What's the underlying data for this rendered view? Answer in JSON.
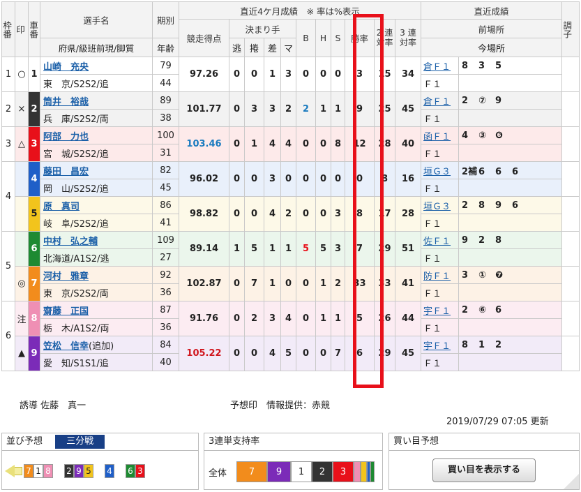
{
  "header": {
    "waku": "枠番",
    "shirushi": "印",
    "sha": "車番",
    "player_line1": "選手名",
    "player_line2": "府県/級班前現/脚質",
    "period_line1": "期別",
    "period_line2": "年齢",
    "recent4": "直近4ケ月成績　※ 率は%表示",
    "score": "競走得点",
    "kimarite": "決まり手",
    "nige": "逃",
    "makuri": "捲",
    "sashi": "差",
    "ma": "マ",
    "b": "B",
    "h": "H",
    "s": "S",
    "win_rate": "勝率",
    "ren2": "2 連 対率",
    "ren3": "3 連 対率",
    "recent_results": "直近成績",
    "prev_venue": "前場所",
    "this_venue": "今場所",
    "condition": "調子"
  },
  "riders": [
    {
      "waku": "1",
      "mark": "○",
      "car": "1",
      "car_bg": "#ffffff",
      "car_fg": "#222222",
      "row_bg": "#ffffff",
      "name": "山崎　充央",
      "pref": "東　京/S2S2/追",
      "period": "79",
      "age": "44",
      "score": "97.26",
      "score_color": "#222222",
      "nige": "0",
      "makuri": "0",
      "sashi": "1",
      "ma": "3",
      "b": "0",
      "h": "0",
      "s": "0",
      "b_color": "#222222",
      "win": "3",
      "ren2": "15",
      "ren3": "34",
      "prev": "倉Ｆ１",
      "prev_res": [
        "8",
        "3",
        "5"
      ],
      "cur": "Ｆ１"
    },
    {
      "waku": "2",
      "mark": "×",
      "car": "2",
      "car_bg": "#333333",
      "car_fg": "#ffffff",
      "row_bg": "#f2f2f2",
      "name": "筒井　裕哉",
      "pref": "兵　庫/S2S2/両",
      "period": "89",
      "age": "38",
      "score": "101.77",
      "score_color": "#222222",
      "nige": "0",
      "makuri": "3",
      "sashi": "3",
      "ma": "2",
      "b": "2",
      "h": "1",
      "s": "1",
      "b_color": "#1a7bbf",
      "win": "9",
      "ren2": "25",
      "ren3": "45",
      "prev": "倉Ｆ１",
      "prev_res": [
        "2",
        "⑦",
        "9"
      ],
      "cur": "Ｆ１"
    },
    {
      "waku": "3",
      "mark": "△",
      "car": "3",
      "car_bg": "#e8101a",
      "car_fg": "#ffffff",
      "row_bg": "#fdeaea",
      "name": "阿部　力也",
      "pref": "宮　城/S2S2/追",
      "period": "100",
      "age": "31",
      "score": "103.46",
      "score_color": "#1a7bbf",
      "nige": "0",
      "makuri": "1",
      "sashi": "4",
      "ma": "4",
      "b": "0",
      "h": "0",
      "s": "8",
      "b_color": "#222222",
      "win": "12",
      "ren2": "28",
      "ren3": "40",
      "prev": "函Ｆ１",
      "prev_res": [
        "4",
        "③",
        "❻"
      ],
      "cur": "Ｆ１"
    },
    {
      "waku": "4",
      "mark": "",
      "car": "4",
      "car_bg": "#1f5fc8",
      "car_fg": "#ffffff",
      "row_bg": "#e9f0fb",
      "name": "藤田　昌宏",
      "pref": "岡　山/S2S2/追",
      "period": "82",
      "age": "45",
      "score": "96.02",
      "score_color": "#222222",
      "nige": "0",
      "makuri": "0",
      "sashi": "3",
      "ma": "0",
      "b": "0",
      "h": "0",
      "s": "0",
      "b_color": "#222222",
      "win": "0",
      "ren2": "8",
      "ren3": "16",
      "prev": "垣Ｇ３",
      "prev_res": [
        "2補",
        "6",
        "6",
        "6"
      ],
      "cur": "Ｆ１"
    },
    {
      "waku": "",
      "mark": "",
      "car": "5",
      "car_bg": "#f2c41c",
      "car_fg": "#222222",
      "row_bg": "#fdf9e8",
      "name": "原　真司",
      "pref": "岐　阜/S2S2/追",
      "period": "86",
      "age": "41",
      "score": "98.82",
      "score_color": "#222222",
      "nige": "0",
      "makuri": "0",
      "sashi": "4",
      "ma": "2",
      "b": "0",
      "h": "0",
      "s": "3",
      "b_color": "#222222",
      "win": "8",
      "ren2": "17",
      "ren3": "28",
      "prev": "垣Ｇ３",
      "prev_res": [
        "2",
        "8",
        "9",
        "6"
      ],
      "cur": "Ｆ１"
    },
    {
      "waku": "5",
      "mark": "",
      "car": "6",
      "car_bg": "#1e8a32",
      "car_fg": "#ffffff",
      "row_bg": "#ebf6ec",
      "name": "中村　弘之輔",
      "pref": "北海道/A1S2/逃",
      "period": "109",
      "age": "27",
      "score": "89.14",
      "score_color": "#222222",
      "nige": "1",
      "makuri": "5",
      "sashi": "1",
      "ma": "1",
      "b": "5",
      "h": "5",
      "s": "3",
      "b_color": "#e8101a",
      "win": "7",
      "ren2": "29",
      "ren3": "51",
      "prev": "佐Ｆ１",
      "prev_res": [
        "9",
        "2",
        "8"
      ],
      "cur": "Ｆ１"
    },
    {
      "waku": "",
      "mark": "◎",
      "car": "7",
      "car_bg": "#f28c1c",
      "car_fg": "#ffffff",
      "row_bg": "#fdf2e6",
      "name": "河村　雅章",
      "pref": "東　京/S2S2/両",
      "period": "92",
      "age": "36",
      "score": "102.87",
      "score_color": "#222222",
      "nige": "0",
      "makuri": "7",
      "sashi": "1",
      "ma": "0",
      "b": "0",
      "h": "1",
      "s": "2",
      "b_color": "#222222",
      "win": "33",
      "ren2": "33",
      "ren3": "41",
      "prev": "防Ｆ１",
      "prev_res": [
        "3",
        "①",
        "❼"
      ],
      "cur": "Ｆ１"
    },
    {
      "waku": "6",
      "mark": "注",
      "car": "8",
      "car_bg": "#ef8fb4",
      "car_fg": "#ffffff",
      "row_bg": "#fcecf2",
      "name": "齋藤　正国",
      "pref": "栃　木/A1S2/両",
      "period": "87",
      "age": "36",
      "score": "91.76",
      "score_color": "#222222",
      "nige": "0",
      "makuri": "2",
      "sashi": "3",
      "ma": "4",
      "b": "0",
      "h": "1",
      "s": "1",
      "b_color": "#222222",
      "win": "5",
      "ren2": "26",
      "ren3": "44",
      "prev": "宇Ｆ１",
      "prev_res": [
        "2",
        "⑥",
        "6"
      ],
      "cur": "Ｆ１"
    },
    {
      "waku": "",
      "mark": "▲",
      "car": "9",
      "car_bg": "#7b2bb8",
      "car_fg": "#ffffff",
      "row_bg": "#f2ebf8",
      "name": "笠松　信幸",
      "name_suffix": "(追加)",
      "pref": "愛　知/S1S1/追",
      "period": "84",
      "age": "40",
      "score": "105.22",
      "score_color": "#d0151c",
      "nige": "0",
      "makuri": "0",
      "sashi": "4",
      "ma": "5",
      "b": "0",
      "h": "0",
      "s": "7",
      "b_color": "#222222",
      "win": "6",
      "ren2": "29",
      "ren3": "45",
      "prev": "宇Ｆ１",
      "prev_res": [
        "8",
        "1",
        "2"
      ],
      "cur": "Ｆ１"
    }
  ],
  "footer": {
    "yudo": "誘導 佐藤　真一",
    "yoso_mark": "予想印　情報提供：赤競",
    "updated": "2019/07/29 07:05 更新"
  },
  "narabi": {
    "title": "並び予想",
    "badge": "三分戦",
    "groups": [
      [
        {
          "n": "7",
          "c": "#f28c1c"
        },
        {
          "n": "1",
          "c": "#ffffff"
        },
        {
          "n": "8",
          "c": "#ef8fb4"
        }
      ],
      [
        {
          "n": "2",
          "c": "#333333"
        },
        {
          "n": "9",
          "c": "#7b2bb8"
        },
        {
          "n": "5",
          "c": "#f2c41c"
        }
      ],
      [
        {
          "n": "4",
          "c": "#1f5fc8"
        }
      ],
      [
        {
          "n": "6",
          "c": "#1e8a32"
        },
        {
          "n": "3",
          "c": "#e8101a"
        }
      ]
    ]
  },
  "support": {
    "title": "3連単支持率",
    "label": "全体",
    "segments": [
      {
        "n": "7",
        "c": "#f28c1c",
        "w": 44
      },
      {
        "n": "9",
        "c": "#7b2bb8",
        "w": 34
      },
      {
        "n": "1",
        "c": "#ffffff",
        "w": 30
      },
      {
        "n": "2",
        "c": "#333333",
        "w": 30
      },
      {
        "n": "3",
        "c": "#e8101a",
        "w": 30
      },
      {
        "n": "",
        "c": "#ef8fb4",
        "w": 10
      },
      {
        "n": "",
        "c": "#f2c41c",
        "w": 9
      },
      {
        "n": "",
        "c": "#1f5fc8",
        "w": 5
      },
      {
        "n": "",
        "c": "#1e8a32",
        "w": 6
      }
    ]
  },
  "kaime": {
    "title": "買い目予想",
    "button": "買い目を表示する"
  }
}
